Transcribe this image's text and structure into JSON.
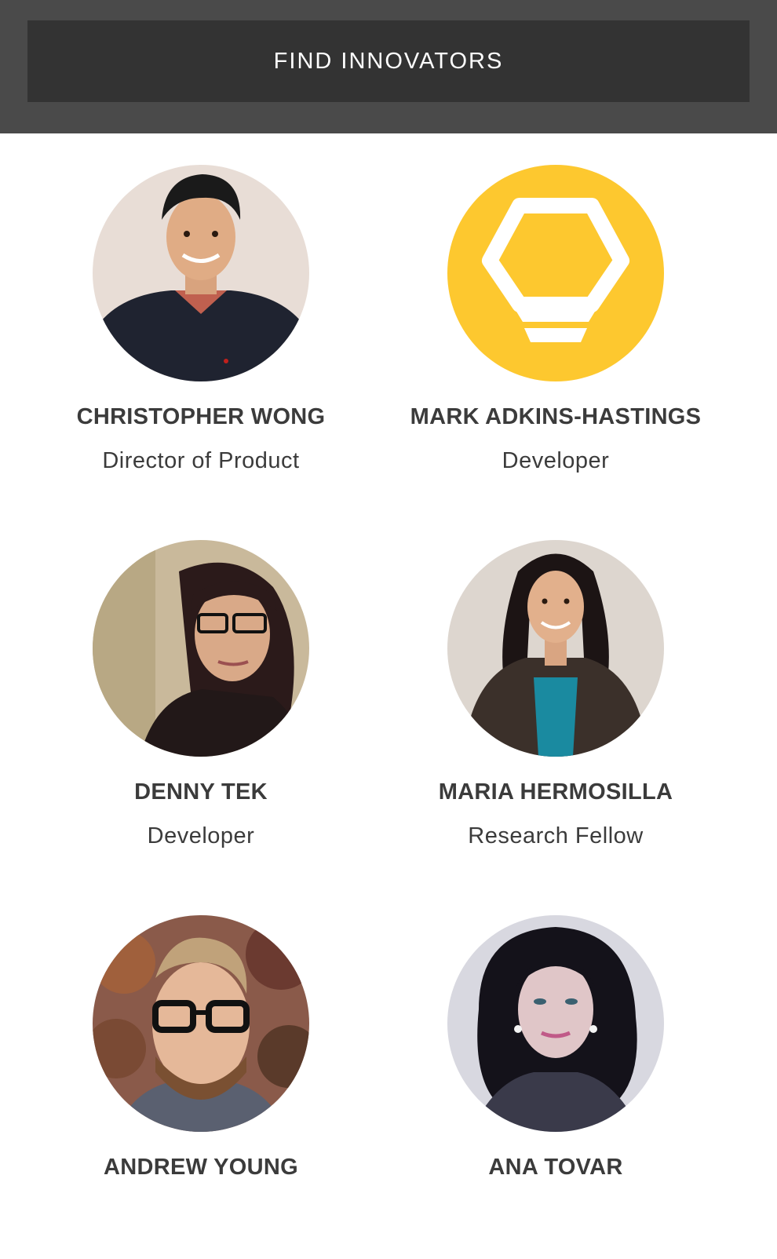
{
  "header": {
    "find_button_label": "FIND INNOVATORS"
  },
  "colors": {
    "header_bg": "#4a4a4a",
    "button_bg": "#333333",
    "logo_yellow": "#fdc82f"
  },
  "innovators": [
    {
      "name": "CHRISTOPHER WONG",
      "role": "Director of Product",
      "avatar": "person-photo"
    },
    {
      "name": "MARK ADKINS-HASTINGS",
      "role": "Developer",
      "avatar": "lightbulb-logo-icon"
    },
    {
      "name": "DENNY TEK",
      "role": "Developer",
      "avatar": "person-photo"
    },
    {
      "name": "MARIA HERMOSILLA",
      "role": "Research Fellow",
      "avatar": "person-photo"
    },
    {
      "name": "ANDREW YOUNG",
      "role": "",
      "avatar": "person-photo"
    },
    {
      "name": "ANA TOVAR",
      "role": "",
      "avatar": "person-photo"
    }
  ]
}
